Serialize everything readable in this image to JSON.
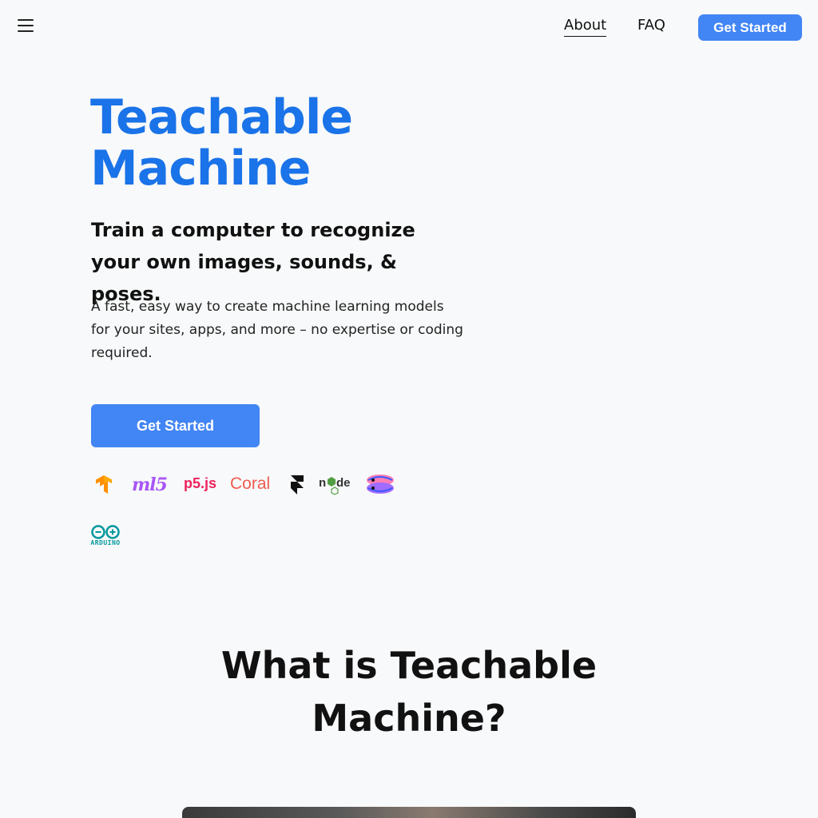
{
  "header": {
    "menu_icon": "hamburger-menu-icon",
    "nav_about": "About",
    "nav_faq": "FAQ",
    "cta_label": "Get Started"
  },
  "hero": {
    "title_line1": "Teachable",
    "title_line2": "Machine",
    "subtitle": "Train a computer to recognize your own images, sounds, & poses.",
    "description": "A fast, easy way to create machine learning models for your sites, apps, and more – no expertise or coding required.",
    "cta_label": "Get Started"
  },
  "logos": {
    "tensorflow": "tensorflow-logo",
    "ml5": "ml5",
    "p5js": "p5.js",
    "coral": "Coral",
    "framer": "framer-logo",
    "node": "node",
    "glitch": "glitch-logo",
    "arduino": "ARDUINO"
  },
  "section": {
    "title_line1": "What is Teachable",
    "title_line2": "Machine?"
  },
  "colors": {
    "brand_blue": "#1a73e8",
    "button_blue": "#4285f4",
    "background": "#f8f9fa"
  }
}
